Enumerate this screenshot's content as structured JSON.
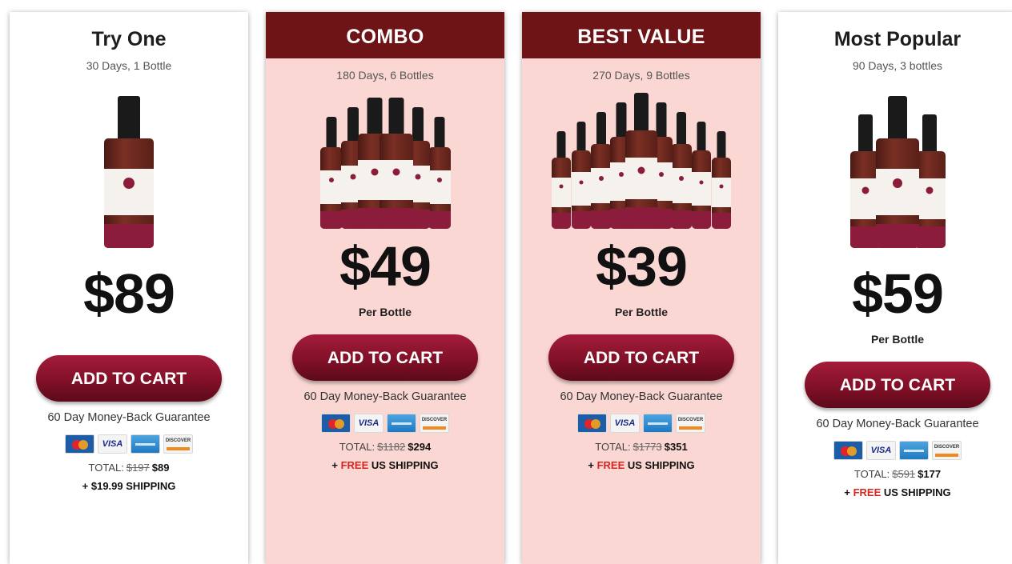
{
  "offers": [
    {
      "title": "Try One",
      "subtitle": "30 Days, 1 Bottle",
      "price": "$89",
      "per_bottle": "",
      "button": "ADD TO CART",
      "guarantee": "60 Day Money-Back Guarantee",
      "total_label": "TOTAL:",
      "total_old": "$197",
      "total_new": "$89",
      "ship_prefix": "+",
      "ship_free": "",
      "ship_text": "$19.99 SHIPPING",
      "bottle_count": 1
    },
    {
      "title": "COMBO",
      "subtitle": "180 Days, 6 Bottles",
      "price": "$49",
      "per_bottle": "Per Bottle",
      "button": "ADD TO CART",
      "guarantee": "60 Day Money-Back Guarantee",
      "total_label": "TOTAL:",
      "total_old": "$1182",
      "total_new": "$294",
      "ship_prefix": "+",
      "ship_free": "FREE",
      "ship_text": "US SHIPPING",
      "bottle_count": 6
    },
    {
      "title": "BEST VALUE",
      "subtitle": "270 Days, 9 Bottles",
      "price": "$39",
      "per_bottle": "Per Bottle",
      "button": "ADD TO CART",
      "guarantee": "60 Day Money-Back Guarantee",
      "total_label": "TOTAL:",
      "total_old": "$1773",
      "total_new": "$351",
      "ship_prefix": "+",
      "ship_free": "FREE",
      "ship_text": "US SHIPPING",
      "bottle_count": 9
    },
    {
      "title": "Most Popular",
      "subtitle": "90 Days, 3 bottles",
      "price": "$59",
      "per_bottle": "Per Bottle",
      "button": "ADD TO CART",
      "guarantee": "60 Day Money-Back Guarantee",
      "total_label": "TOTAL:",
      "total_old": "$591",
      "total_new": "$177",
      "ship_prefix": "+",
      "ship_free": "FREE",
      "ship_text": "US SHIPPING",
      "bottle_count": 3
    }
  ],
  "payment_icons": [
    "mastercard-icon",
    "visa-icon",
    "amex-icon",
    "discover-icon"
  ],
  "payment_visa_text": "VISA",
  "payment_discover_text": "DISCOVER",
  "colors": {
    "banner": "#6e1417",
    "pink_card": "#fbd7d3",
    "button": "#8a1230",
    "free_text": "#d4271f"
  }
}
